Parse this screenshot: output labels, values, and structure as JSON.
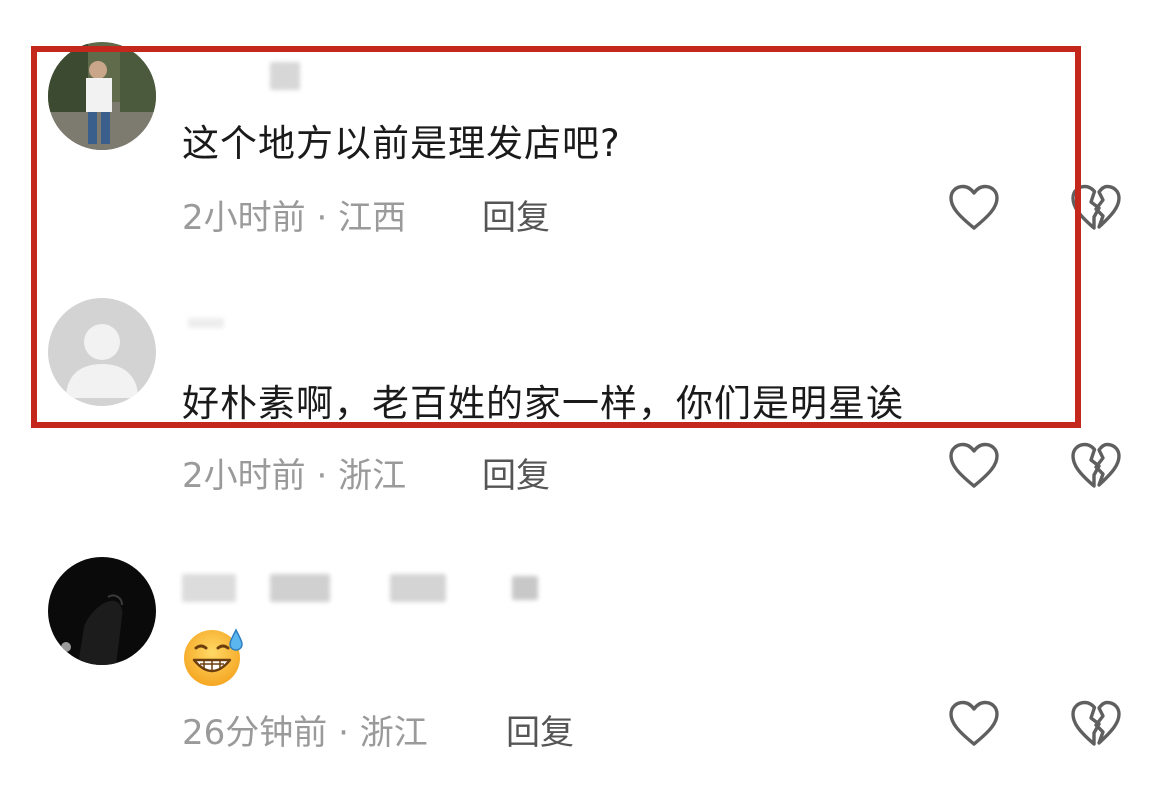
{
  "comments": [
    {
      "text": "这个地方以前是理发店吧?",
      "time": "2小时前",
      "separator": "·",
      "location": "江西",
      "reply_label": "回复"
    },
    {
      "text": "好朴素啊，老百姓的家一样，你们是明星诶",
      "time": "2小时前",
      "separator": "·",
      "location": "浙江",
      "reply_label": "回复"
    },
    {
      "emoji": "grinning-sweat-emoji",
      "time": "26分钟前",
      "separator": "·",
      "location": "浙江",
      "reply_label": "回复"
    }
  ],
  "icons": {
    "like": "heart-outline-icon",
    "dislike": "broken-heart-outline-icon"
  },
  "colors": {
    "highlight_border": "#c4281c",
    "meta_text": "#9a9a9a",
    "body_text": "#1a1a1a"
  }
}
